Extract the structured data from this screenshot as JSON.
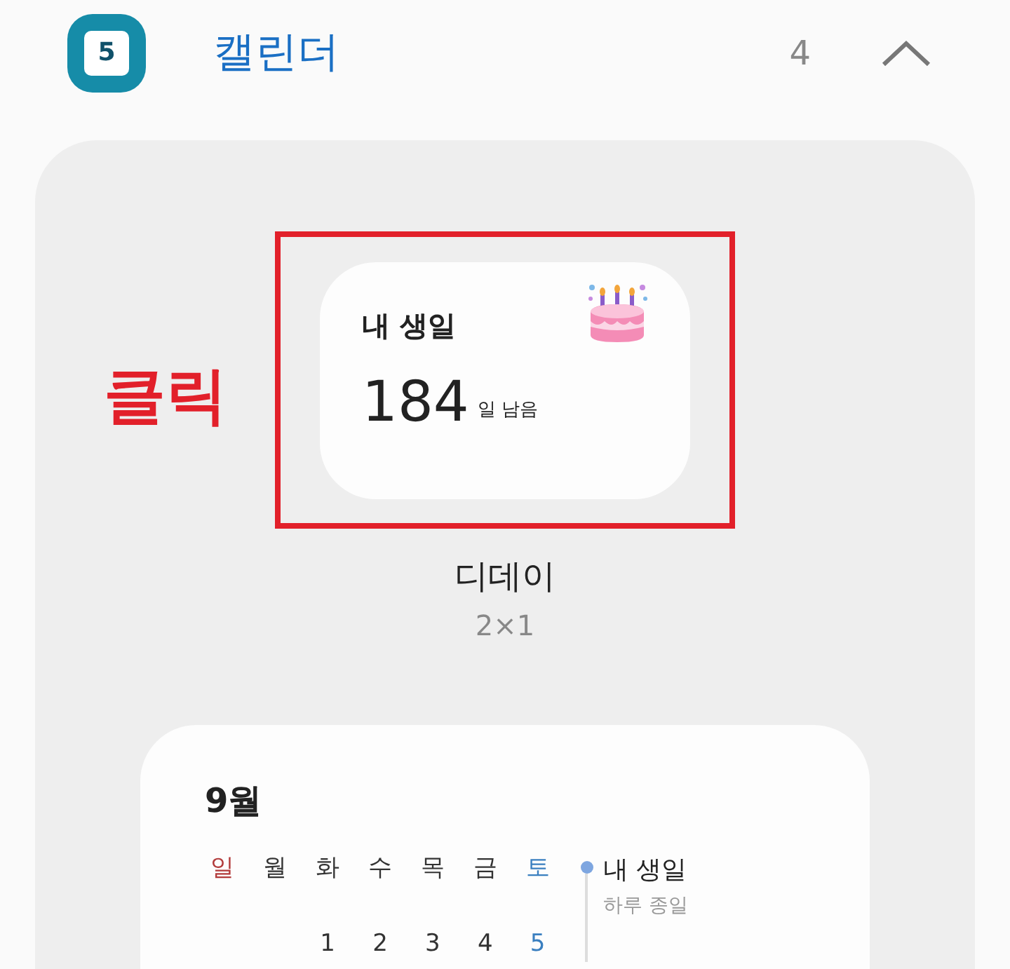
{
  "header": {
    "app_icon_text": "5",
    "title": "캘린더",
    "count": "4",
    "expanded": true
  },
  "annotation": "클릭",
  "widgets": [
    {
      "kind": "dday",
      "title": "내 생일",
      "number": "184",
      "unit": "일 남음",
      "name": "디데이",
      "size": "2×1",
      "highlighted": true
    },
    {
      "kind": "month",
      "month": "9월",
      "weekdays": [
        {
          "label": "일",
          "color": "#b23b3b"
        },
        {
          "label": "월",
          "color": "#333333"
        },
        {
          "label": "화",
          "color": "#333333",
          "date": "1"
        },
        {
          "label": "수",
          "color": "#333333",
          "date": "2"
        },
        {
          "label": "목",
          "color": "#333333",
          "date": "3"
        },
        {
          "label": "금",
          "color": "#333333",
          "date": "4"
        },
        {
          "label": "토",
          "color": "#3a7fc0",
          "date": "5"
        }
      ],
      "event": {
        "title": "내 생일",
        "subtitle": "하루 종일",
        "color": "#7ea6e0"
      }
    }
  ]
}
